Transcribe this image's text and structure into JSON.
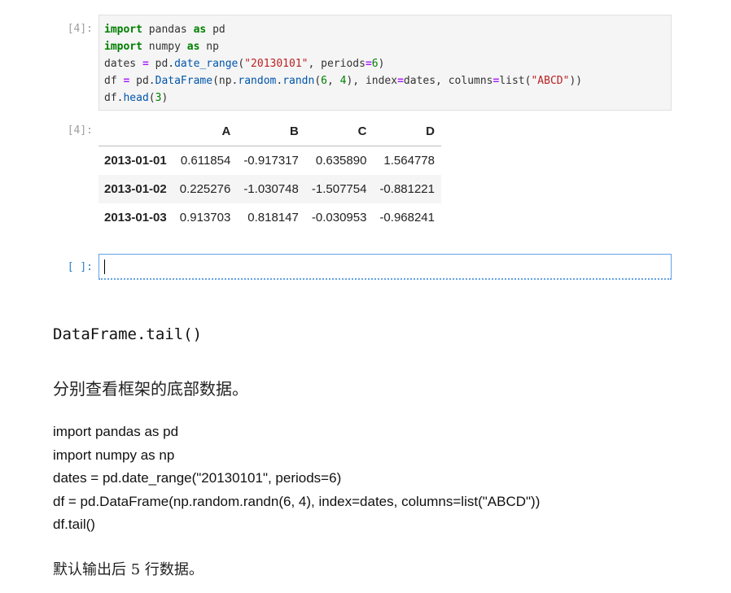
{
  "cell1": {
    "prompt": "[4]:",
    "code_lines": [
      [
        {
          "t": "import",
          "c": "kw"
        },
        {
          "t": " pandas ",
          "c": ""
        },
        {
          "t": "as",
          "c": "kw"
        },
        {
          "t": " pd",
          "c": ""
        }
      ],
      [
        {
          "t": "import",
          "c": "kw"
        },
        {
          "t": " numpy ",
          "c": ""
        },
        {
          "t": "as",
          "c": "kw"
        },
        {
          "t": " np",
          "c": ""
        }
      ],
      [
        {
          "t": "dates ",
          "c": ""
        },
        {
          "t": "=",
          "c": "op"
        },
        {
          "t": " pd.",
          "c": ""
        },
        {
          "t": "date_range",
          "c": "fn"
        },
        {
          "t": "(",
          "c": ""
        },
        {
          "t": "\"20130101\"",
          "c": "str"
        },
        {
          "t": ", periods",
          "c": ""
        },
        {
          "t": "=",
          "c": "op"
        },
        {
          "t": "6",
          "c": "num"
        },
        {
          "t": ")",
          "c": ""
        }
      ],
      [
        {
          "t": "df ",
          "c": ""
        },
        {
          "t": "=",
          "c": "op"
        },
        {
          "t": " pd.",
          "c": ""
        },
        {
          "t": "DataFrame",
          "c": "fn"
        },
        {
          "t": "(np.",
          "c": ""
        },
        {
          "t": "random",
          "c": "fn"
        },
        {
          "t": ".",
          "c": ""
        },
        {
          "t": "randn",
          "c": "fn"
        },
        {
          "t": "(",
          "c": ""
        },
        {
          "t": "6",
          "c": "num"
        },
        {
          "t": ", ",
          "c": ""
        },
        {
          "t": "4",
          "c": "num"
        },
        {
          "t": "), index",
          "c": ""
        },
        {
          "t": "=",
          "c": "op"
        },
        {
          "t": "dates, columns",
          "c": ""
        },
        {
          "t": "=",
          "c": "op"
        },
        {
          "t": "list(",
          "c": ""
        },
        {
          "t": "\"ABCD\"",
          "c": "str"
        },
        {
          "t": "))",
          "c": ""
        }
      ],
      [
        {
          "t": "df.",
          "c": ""
        },
        {
          "t": "head",
          "c": "fn"
        },
        {
          "t": "(",
          "c": ""
        },
        {
          "t": "3",
          "c": "num"
        },
        {
          "t": ")",
          "c": ""
        }
      ]
    ]
  },
  "output1": {
    "prompt": "[4]:",
    "columns": [
      "A",
      "B",
      "C",
      "D"
    ],
    "rows": [
      {
        "index": "2013-01-01",
        "values": [
          "0.611854",
          "-0.917317",
          "0.635890",
          "1.564778"
        ]
      },
      {
        "index": "2013-01-02",
        "values": [
          "0.225276",
          "-1.030748",
          "-1.507754",
          "-0.881221"
        ]
      },
      {
        "index": "2013-01-03",
        "values": [
          "0.913703",
          "0.818147",
          "-0.030953",
          "-0.968241"
        ]
      }
    ]
  },
  "cell2": {
    "prompt": "[ ]:"
  },
  "doc": {
    "heading": "DataFrame.tail()",
    "description": "分别查看框架的底部数据。",
    "code_lines": [
      "import pandas as pd",
      "import numpy as np",
      "dates = pd.date_range(\"20130101\", periods=6)",
      "df = pd.DataFrame(np.random.randn(6, 4), index=dates, columns=list(\"ABCD\"))",
      "df.tail()"
    ],
    "note": "默认输出后 5 行数据。"
  },
  "colors": {
    "cell_background": "#f5f5f5",
    "active_prompt": "#307fc1",
    "active_border": "#64a2e6",
    "keyword": "#008000",
    "string": "#ba2121"
  }
}
